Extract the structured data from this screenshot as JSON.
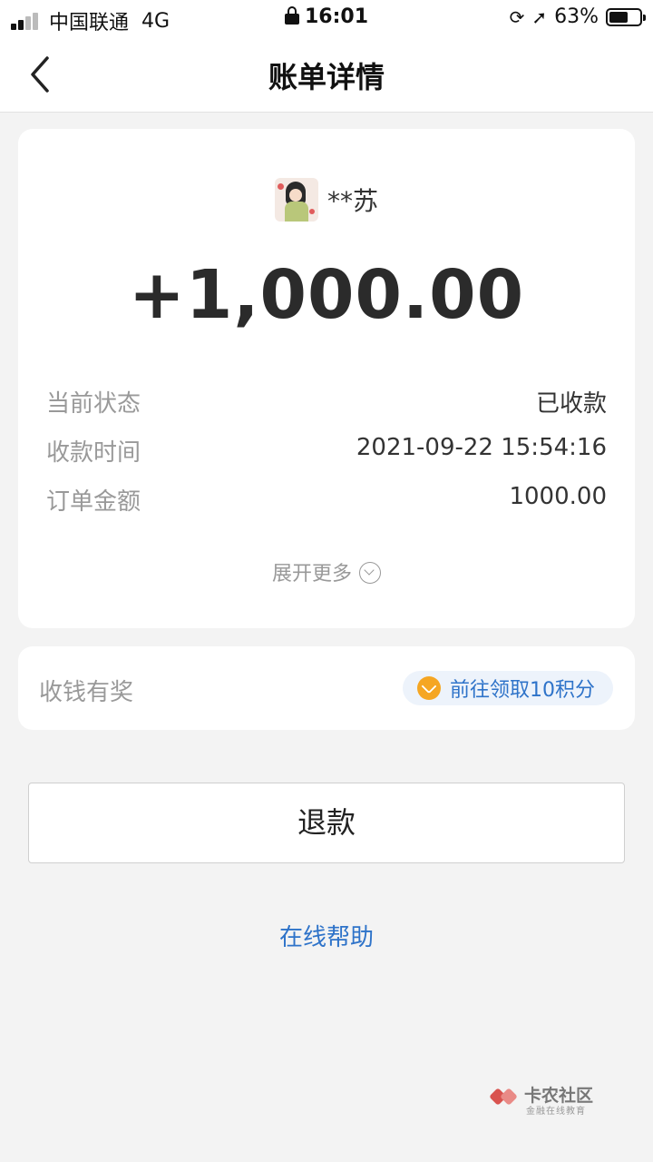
{
  "status_bar": {
    "carrier": "中国联通",
    "network": "4G",
    "time": "16:01",
    "battery_percent_label": "63%",
    "battery_level": 0.63
  },
  "nav": {
    "title": "账单详情"
  },
  "payment": {
    "payer_name": "**苏",
    "amount": "+1,000.00",
    "rows": [
      {
        "label": "当前状态",
        "value": "已收款"
      },
      {
        "label": "收款时间",
        "value": "2021-09-22 15:54:16"
      },
      {
        "label": "订单金额",
        "value": "1000.00"
      }
    ],
    "expand_label": "展开更多"
  },
  "reward": {
    "label": "收钱有奖",
    "action_label": "前往领取10积分"
  },
  "actions": {
    "refund_label": "退款",
    "help_label": "在线帮助"
  },
  "watermark": {
    "title": "卡农社区",
    "subtitle": "金融在线教育"
  },
  "colors": {
    "background": "#f3f3f3",
    "accent_blue": "#2e73c9",
    "coin_orange": "#f5a623"
  }
}
